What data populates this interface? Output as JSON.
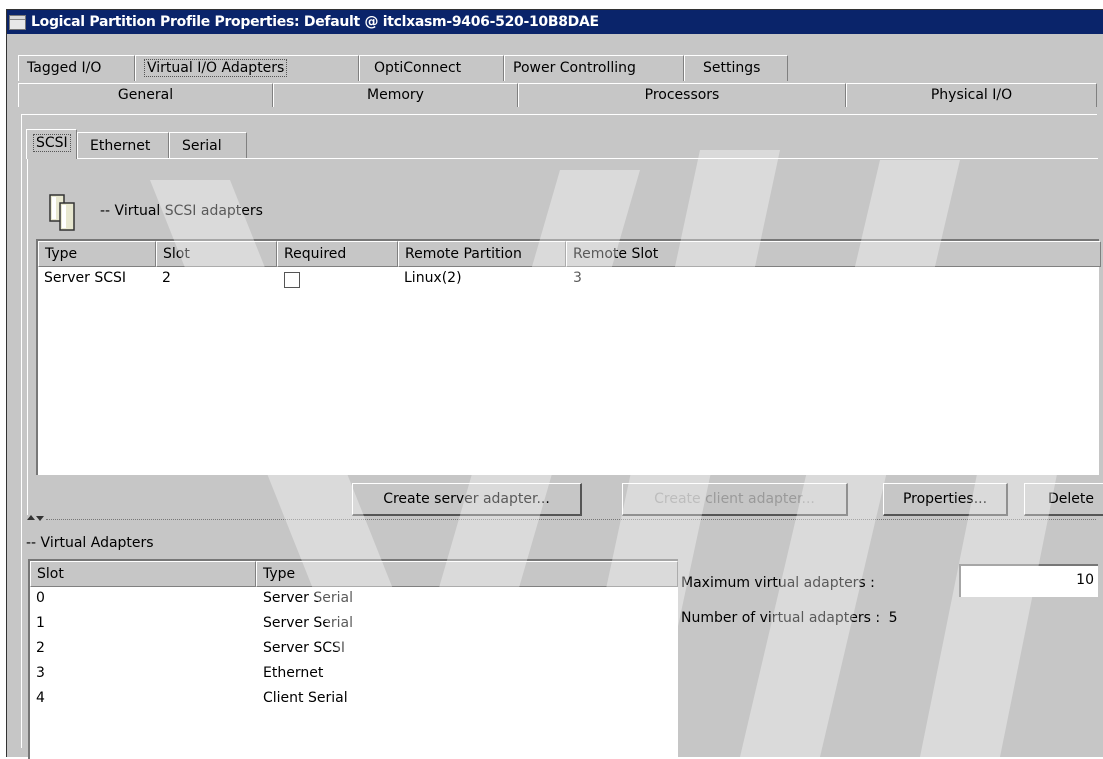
{
  "window": {
    "title": "Logical Partition Profile Properties: Default @ itclxasm-9406-520-10B8DAE"
  },
  "tabs_row1": [
    "Tagged I/O",
    "Virtual I/O Adapters",
    "OptiConnect",
    "Power Controlling",
    "Settings"
  ],
  "tabs_row2": [
    "General",
    "Memory",
    "Processors",
    "Physical I/O"
  ],
  "selected_tab": "Virtual I/O Adapters",
  "subtabs": [
    "SCSI",
    "Ethernet",
    "Serial"
  ],
  "selected_subtab": "SCSI",
  "scsi_section": {
    "icon": "scsi-adapter-icon",
    "label": "-- Virtual SCSI adapters",
    "columns": [
      "Type",
      "Slot",
      "Required",
      "Remote Partition",
      "Remote Slot"
    ],
    "rows": [
      {
        "type": "Server SCSI",
        "slot": "2",
        "required": false,
        "remote_partition": "Linux(2)",
        "remote_slot": "3"
      }
    ]
  },
  "buttons": {
    "create_server": "Create server adapter...",
    "create_client": "Create client adapter...",
    "properties": "Properties...",
    "delete": "Delete"
  },
  "virtual_adapters": {
    "label": "-- Virtual Adapters",
    "columns": [
      "Slot",
      "Type"
    ],
    "rows": [
      {
        "slot": "0",
        "type": "Server Serial"
      },
      {
        "slot": "1",
        "type": "Server Serial"
      },
      {
        "slot": "2",
        "type": "Server SCSI"
      },
      {
        "slot": "3",
        "type": "Ethernet"
      },
      {
        "slot": "4",
        "type": "Client Serial"
      }
    ],
    "max_label": "Maximum virtual adapters :",
    "max_value": "10",
    "number_label": "Number of virtual adapters :",
    "number_value": "5"
  },
  "colors": {
    "titlebar": "#0a246a",
    "panel": "#c6c6c6",
    "disabled_text": "#9a9a9a"
  }
}
